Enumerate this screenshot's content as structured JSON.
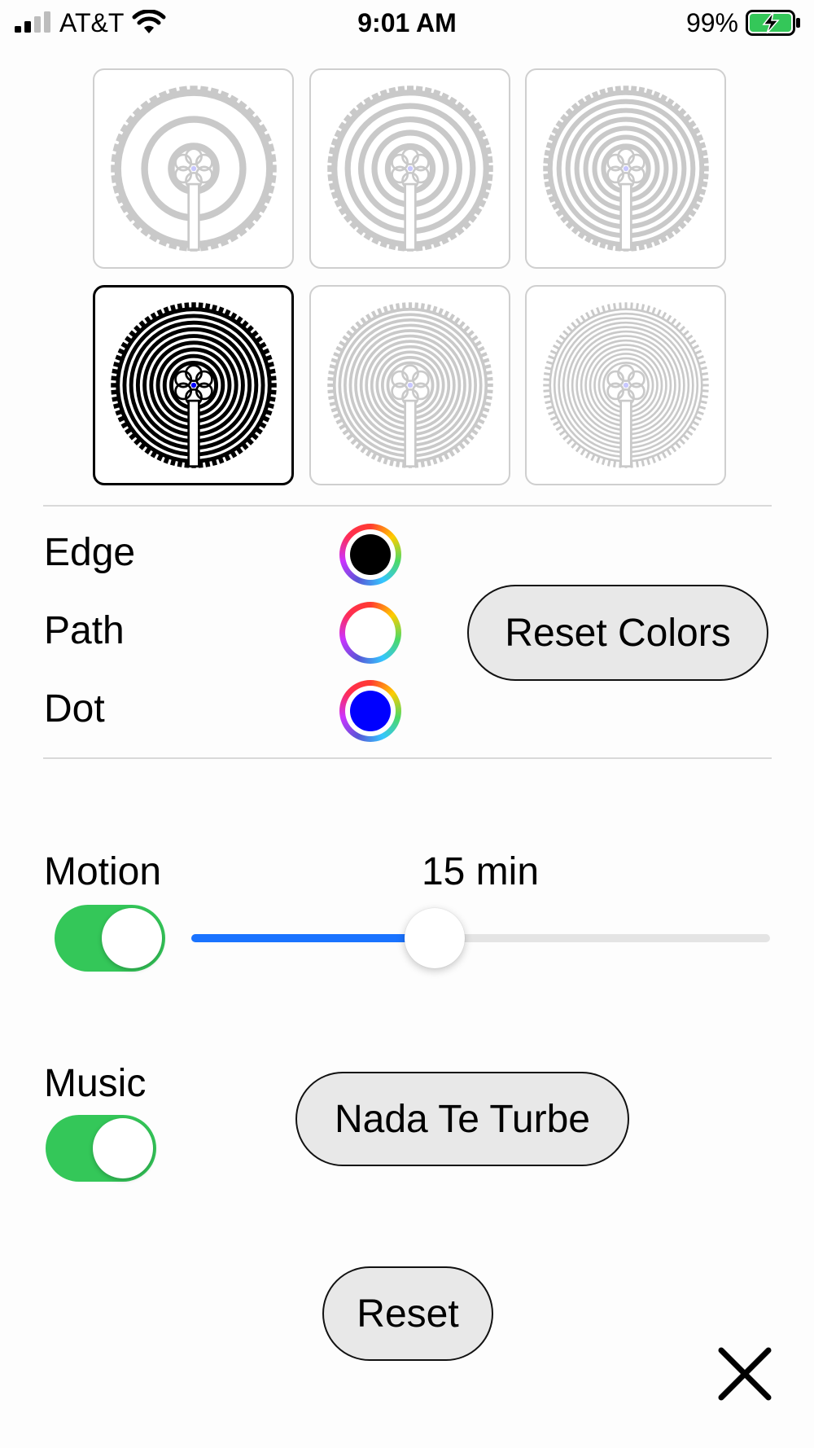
{
  "status_bar": {
    "carrier": "AT&T",
    "time": "9:01 AM",
    "battery_percent": "99%",
    "icons": [
      "signal-icon",
      "wifi-icon",
      "battery-charging-icon"
    ]
  },
  "labyrinths": {
    "selected_index": 3,
    "items": [
      {
        "name": "labyrinth-1",
        "rings": 2
      },
      {
        "name": "labyrinth-2",
        "rings": 4
      },
      {
        "name": "labyrinth-3",
        "rings": 6
      },
      {
        "name": "labyrinth-4",
        "rings": 8
      },
      {
        "name": "labyrinth-5",
        "rings": 10
      },
      {
        "name": "labyrinth-6",
        "rings": 12
      }
    ]
  },
  "colors": {
    "edge": {
      "label": "Edge",
      "value": "#000000"
    },
    "path": {
      "label": "Path",
      "value": "#ffffff"
    },
    "dot": {
      "label": "Dot",
      "value": "#0000ff"
    },
    "reset_label": "Reset Colors"
  },
  "motion": {
    "label": "Motion",
    "enabled": true,
    "duration_label": "15 min",
    "slider_fraction": 0.42
  },
  "music": {
    "label": "Music",
    "enabled": true,
    "track_label": "Nada Te Turbe"
  },
  "reset_label": "Reset",
  "close_icon": "close-icon",
  "accent_color": "#1a73ff",
  "toggle_color": "#34c759"
}
